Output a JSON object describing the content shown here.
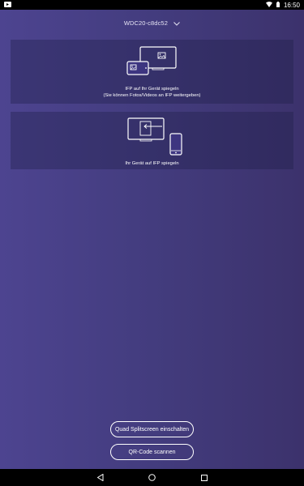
{
  "status_bar": {
    "time": "16:50",
    "icons": [
      "notification-icon",
      "wifi-icon",
      "battery-icon"
    ]
  },
  "device_selector": {
    "device_name": "WDC20-c8dc52",
    "icon": "chevron-down-icon"
  },
  "cards": [
    {
      "line1": "IFP auf Ihr Gerät spiegeln",
      "line2": "(Sie können Fotos/Videos an IFP weitergeben)",
      "icon": "ifp-to-device-mirror-icon"
    },
    {
      "line1": "Ihr Gerät auf IFP spiegeln",
      "icon": "device-to-ifp-mirror-icon"
    }
  ],
  "buttons": {
    "quad_split": "Quad Splitscreen einschalten",
    "qr_scan": "QR-Code scannen"
  },
  "nav_bar": {
    "icons": [
      "back-icon",
      "home-icon",
      "recents-icon"
    ]
  },
  "colors": {
    "background_start": "#4d4490",
    "background_end": "#3c326c",
    "card_background": "#2e2a5e",
    "text": "#ffffff"
  }
}
